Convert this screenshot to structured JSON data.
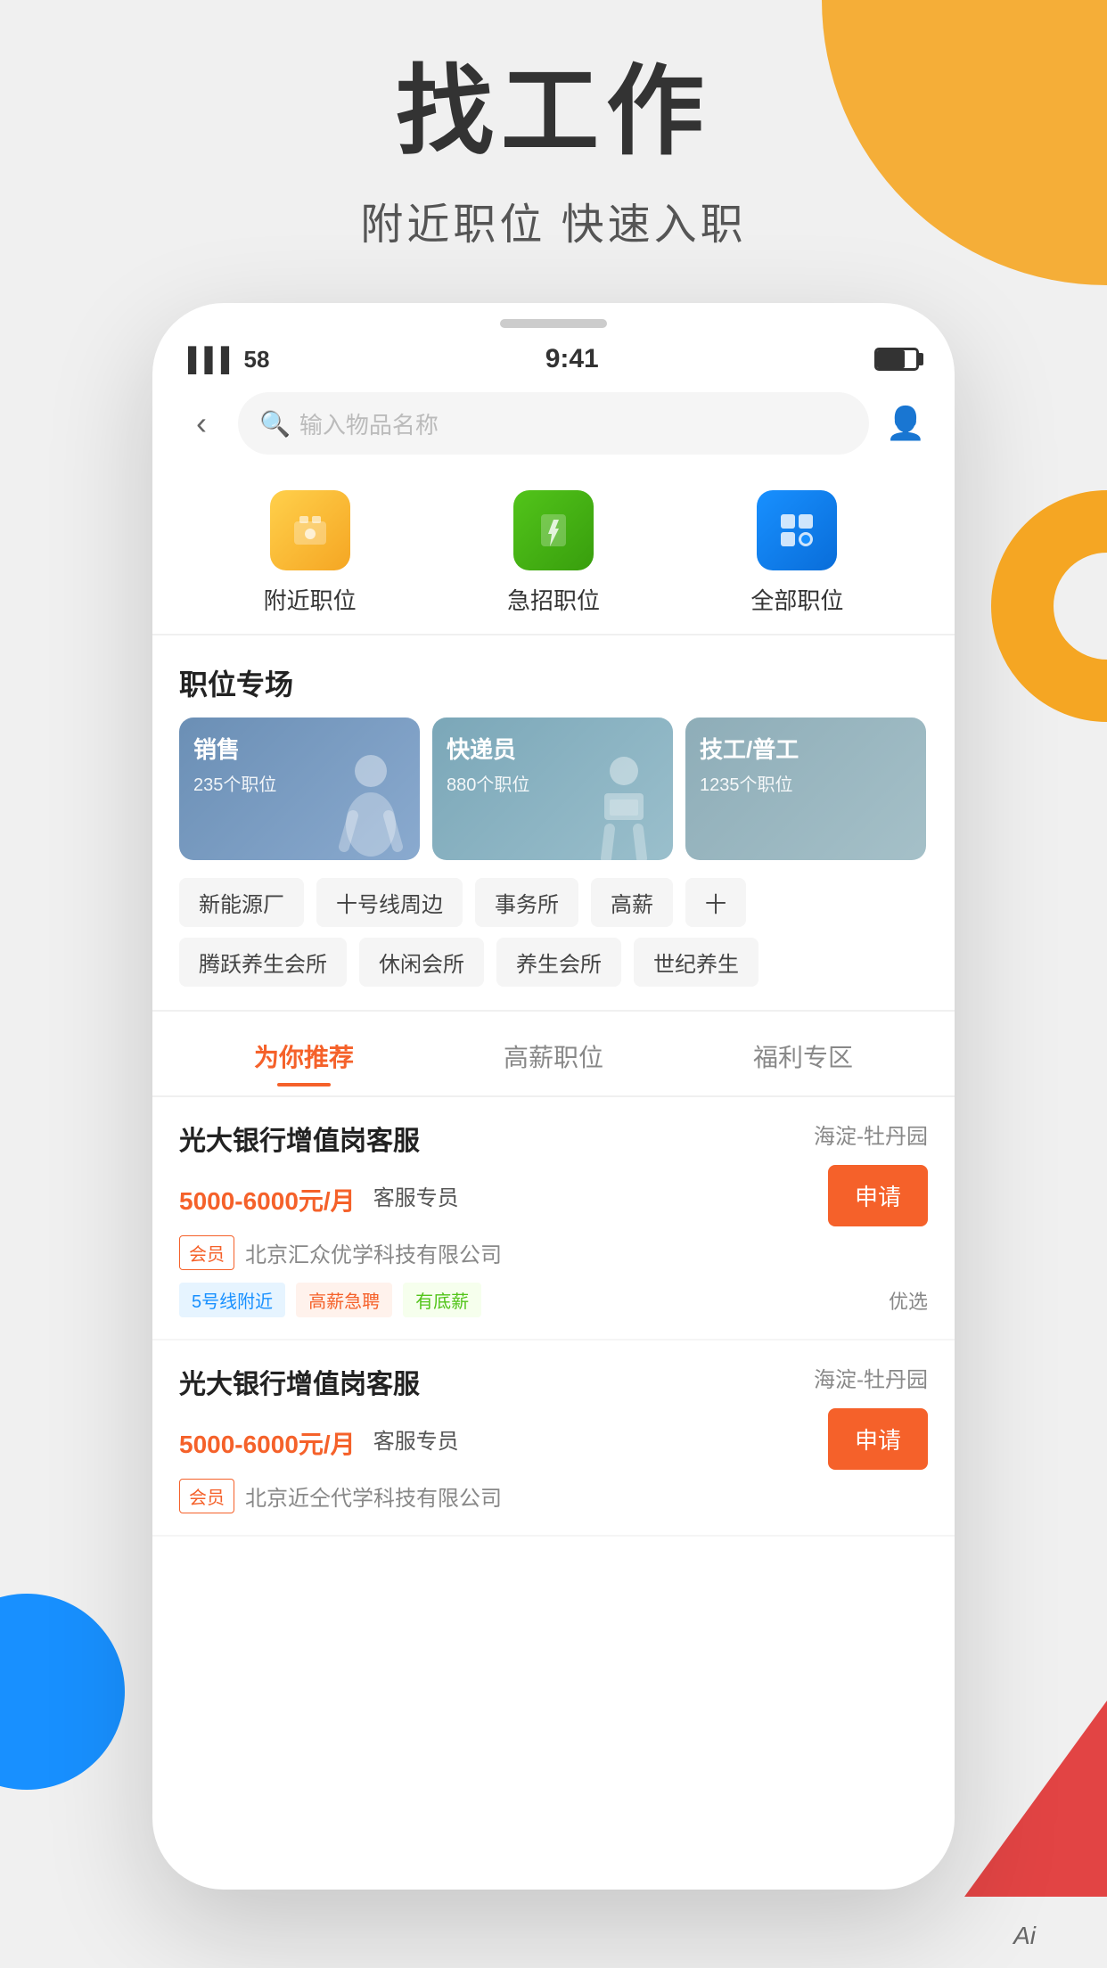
{
  "page": {
    "main_title": "找工作",
    "sub_title": "附近职位 快速入职"
  },
  "status_bar": {
    "signal": "58",
    "time": "9:41",
    "battery": "70"
  },
  "search": {
    "placeholder": "输入物品名称"
  },
  "categories": [
    {
      "id": "nearby",
      "icon": "📍",
      "label": "附近职位"
    },
    {
      "id": "urgent",
      "icon": "⚡",
      "label": "急招职位"
    },
    {
      "id": "all",
      "icon": "⊞",
      "label": "全部职位"
    }
  ],
  "section_title": "职位专场",
  "job_cards": [
    {
      "id": "sales",
      "title": "销售",
      "count": "235个职位",
      "color_from": "#6B8FB5",
      "color_to": "#8AAACF"
    },
    {
      "id": "delivery",
      "title": "快递员",
      "count": "880个职位",
      "color_from": "#7BA7B8",
      "color_to": "#9ABFCC"
    },
    {
      "id": "tech",
      "title": "技工/普工",
      "count": "1235个职位",
      "color_from": "#8EADB8",
      "color_to": "#A5C0C8"
    }
  ],
  "tags_row1": [
    "新能源厂",
    "十号线周边",
    "事务所",
    "高薪",
    "+"
  ],
  "tags_row2": [
    "腾跃养生会所",
    "休闲会所",
    "养生会所",
    "世纪养生"
  ],
  "tabs": [
    {
      "id": "recommend",
      "label": "为你推荐",
      "active": true
    },
    {
      "id": "high_salary",
      "label": "高薪职位",
      "active": false
    },
    {
      "id": "welfare",
      "label": "福利专区",
      "active": false
    }
  ],
  "job_listings": [
    {
      "id": "job1",
      "title": "光大银行增值岗客服",
      "location": "海淀-牡丹园",
      "salary": "5000-6000元/月",
      "job_type": "客服专员",
      "member_badge": "会员",
      "company": "北京汇众优学科技有限公司",
      "apply_label": "申请",
      "tags": [
        "5号线附近",
        "高薪急聘",
        "有底薪"
      ],
      "tag_types": [
        "blue",
        "orange",
        "green"
      ],
      "preferred": "优选"
    },
    {
      "id": "job2",
      "title": "光大银行增值岗客服",
      "location": "海淀-牡丹园",
      "salary": "5000-6000元/月",
      "job_type": "客服专员",
      "member_badge": "会员",
      "company": "北京近仝代学科技有限公司",
      "apply_label": "申请",
      "tags": [],
      "tag_types": [],
      "preferred": ""
    }
  ],
  "app_label": "Ai"
}
